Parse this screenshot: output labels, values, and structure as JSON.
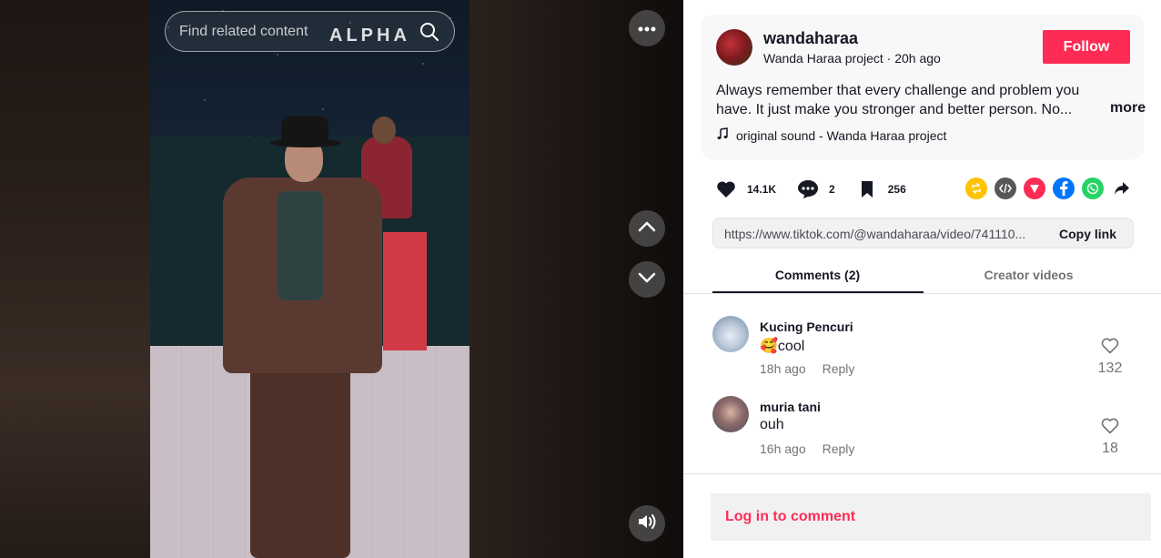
{
  "video": {
    "search_placeholder": "Find related content",
    "watermark": "ALPHA",
    "icons": {
      "search": "search-icon",
      "more": "more-dots-icon",
      "up": "chevron-up-icon",
      "down": "chevron-down-icon",
      "volume": "volume-icon"
    }
  },
  "post": {
    "author_username": "wandaharaa",
    "author_subtitle": "Wanda Haraa project · 20h ago",
    "follow_label": "Follow",
    "caption": "Always remember that every challenge and problem you have. It just make you stronger and better person. No...",
    "more_label": "more",
    "music": "original sound - Wanda Haraa project"
  },
  "stats": {
    "likes": "14.1K",
    "comments": "2",
    "saves": "256"
  },
  "share": {
    "icons": [
      "repost-icon",
      "embed-icon",
      "send-icon",
      "facebook-icon",
      "whatsapp-icon",
      "share-arrow-icon"
    ],
    "colors": {
      "repost": "#ffc300",
      "embed": "#575757",
      "send": "#fe2c55",
      "facebook": "#0075fa",
      "whatsapp": "#25d366"
    }
  },
  "link": {
    "url": "https://www.tiktok.com/@wandaharaa/video/741110...",
    "copy_label": "Copy link"
  },
  "tabs": {
    "comments": "Comments (2)",
    "creator": "Creator videos"
  },
  "comments": [
    {
      "author": "Kucing Pencuri",
      "text": "🥰cool",
      "time": "18h ago",
      "reply": "Reply",
      "likes": "132"
    },
    {
      "author": "muria tani",
      "text": "ouh",
      "time": "16h ago",
      "reply": "Reply",
      "likes": "18"
    }
  ],
  "login": {
    "label": "Log in to comment"
  },
  "colors": {
    "accent": "#fe2c55",
    "text": "#161823",
    "muted": "#737373"
  }
}
